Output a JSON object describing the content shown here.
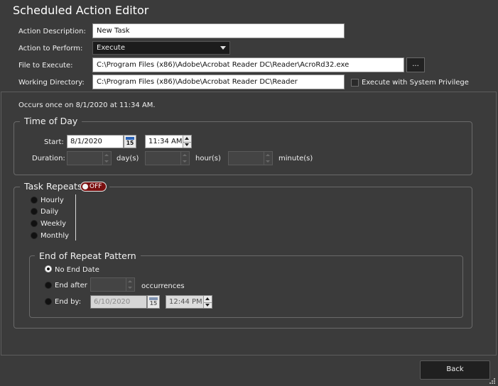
{
  "window": {
    "title": "Scheduled Action Editor"
  },
  "form": {
    "action_description": {
      "label": "Action Description:",
      "value": "New Task"
    },
    "action_to_perform": {
      "label": "Action to Perform:",
      "value": "Execute"
    },
    "file_to_execute": {
      "label": "File to Execute:",
      "value": "C:\\Program Files (x86)\\Adobe\\Acrobat Reader DC\\Reader\\AcroRd32.exe",
      "browse_label": "..."
    },
    "working_directory": {
      "label": "Working Directory:",
      "value": "C:\\Program Files (x86)\\Adobe\\Acrobat Reader DC\\Reader"
    },
    "system_privilege": {
      "label": "Execute with System Privilege",
      "checked": false
    }
  },
  "summary": "Occurs once on 8/1/2020 at 11:34 AM.",
  "time_of_day": {
    "title": "Time of Day",
    "start_label": "Start:",
    "start_date": "8/1/2020",
    "calendar_day": "15",
    "start_time": "11:34 AM",
    "duration_label": "Duration:",
    "days_unit": "day(s)",
    "hours_unit": "hour(s)",
    "minutes_unit": "minute(s)"
  },
  "task_repeats": {
    "title": "Task Repeats",
    "toggle_label": "OFF",
    "options": [
      "Hourly",
      "Daily",
      "Weekly",
      "Monthly"
    ]
  },
  "end_of_repeat": {
    "title": "End of Repeat Pattern",
    "no_end_label": "No End Date",
    "end_after_label": "End after",
    "occurrences_label": "occurrences",
    "end_by_label": "End by:",
    "end_by_date": "6/10/2020",
    "calendar_day": "15",
    "end_by_time": "12:44 PM",
    "selected": "No End Date"
  },
  "buttons": {
    "back_label": "Back"
  },
  "colors": {
    "background": "#3b3b3b",
    "toggle_off": "#7a1010",
    "calendar_accent": "#2a63b8"
  }
}
